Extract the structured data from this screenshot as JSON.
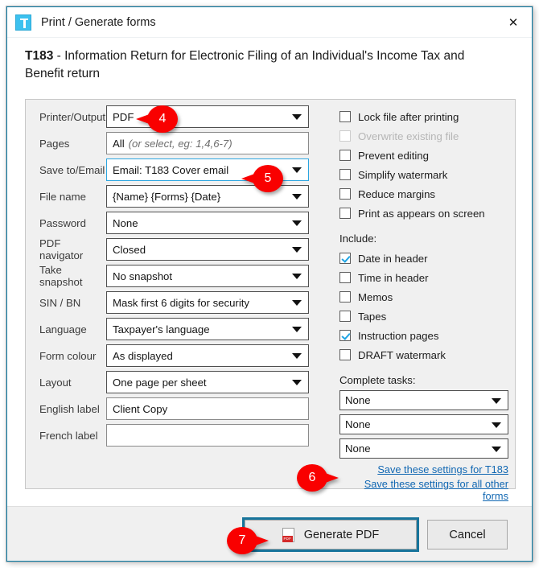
{
  "window": {
    "title": "Print / Generate forms",
    "app_icon": "taxcycle-logo-icon",
    "close_icon": "✕"
  },
  "form_heading": {
    "code": "T183",
    "rest": " - Information Return for Electronic Filing of an Individual's Income Tax and Benefit return"
  },
  "left_fields": [
    {
      "label": "Printer/Output",
      "value": "PDF",
      "type": "select",
      "focused": false
    },
    {
      "label": "Pages",
      "value": "All",
      "hint": "(or select, eg: 1,4,6-7)",
      "type": "text",
      "focused": false
    },
    {
      "label": "Save to/Email",
      "value": "Email: T183 Cover email",
      "type": "select",
      "focused": true
    },
    {
      "label": "File name",
      "value": "{Name} {Forms} {Date}",
      "type": "select",
      "focused": false
    },
    {
      "label": "Password",
      "value": "None",
      "type": "select",
      "focused": false
    },
    {
      "label": "PDF navigator",
      "value": "Closed",
      "type": "select",
      "focused": false
    },
    {
      "label": "Take snapshot",
      "value": "No snapshot",
      "type": "select",
      "focused": false
    },
    {
      "label": "SIN / BN",
      "value": "Mask first 6 digits for security",
      "type": "select",
      "focused": false
    },
    {
      "label": "Language",
      "value": "Taxpayer's language",
      "type": "select",
      "focused": false
    },
    {
      "label": "Form colour",
      "value": "As displayed",
      "type": "select",
      "focused": false
    },
    {
      "label": "Layout",
      "value": "One page per sheet",
      "type": "select",
      "focused": false
    },
    {
      "label": "English label",
      "value": "Client Copy",
      "type": "text",
      "focused": false
    },
    {
      "label": "French label",
      "value": "",
      "type": "text",
      "focused": false
    }
  ],
  "options": [
    {
      "label": "Lock file after printing",
      "checked": false,
      "disabled": false
    },
    {
      "label": "Overwrite existing file",
      "checked": false,
      "disabled": true
    },
    {
      "label": "Prevent editing",
      "checked": false,
      "disabled": false
    },
    {
      "label": "Simplify watermark",
      "checked": false,
      "disabled": false
    },
    {
      "label": "Reduce margins",
      "checked": false,
      "disabled": false
    },
    {
      "label": "Print as appears on screen",
      "checked": false,
      "disabled": false
    }
  ],
  "include": {
    "title": "Include:",
    "items": [
      {
        "label": "Date in header",
        "checked": true,
        "disabled": false
      },
      {
        "label": "Time in header",
        "checked": false,
        "disabled": false
      },
      {
        "label": "Memos",
        "checked": false,
        "disabled": false
      },
      {
        "label": "Tapes",
        "checked": false,
        "disabled": false
      },
      {
        "label": "Instruction pages",
        "checked": true,
        "disabled": false
      },
      {
        "label": "DRAFT watermark",
        "checked": false,
        "disabled": false
      }
    ]
  },
  "complete_tasks": {
    "title": "Complete tasks:",
    "selects": [
      "None",
      "None",
      "None"
    ]
  },
  "links": {
    "save_for_form": "Save these settings for T183",
    "save_for_all": "Save these settings for all other forms"
  },
  "footer": {
    "generate_label": "Generate PDF",
    "generate_icon": "pdf-file-icon",
    "cancel_label": "Cancel"
  },
  "callouts": [
    {
      "number": "4",
      "direction": "left"
    },
    {
      "number": "5",
      "direction": "left"
    },
    {
      "number": "6",
      "direction": "right"
    },
    {
      "number": "7",
      "direction": "right"
    }
  ],
  "colors": {
    "accent": "#0d7ea8",
    "callout_red": "#f90000",
    "check_blue": "#1fa4e3",
    "link_blue": "#1268b3"
  }
}
